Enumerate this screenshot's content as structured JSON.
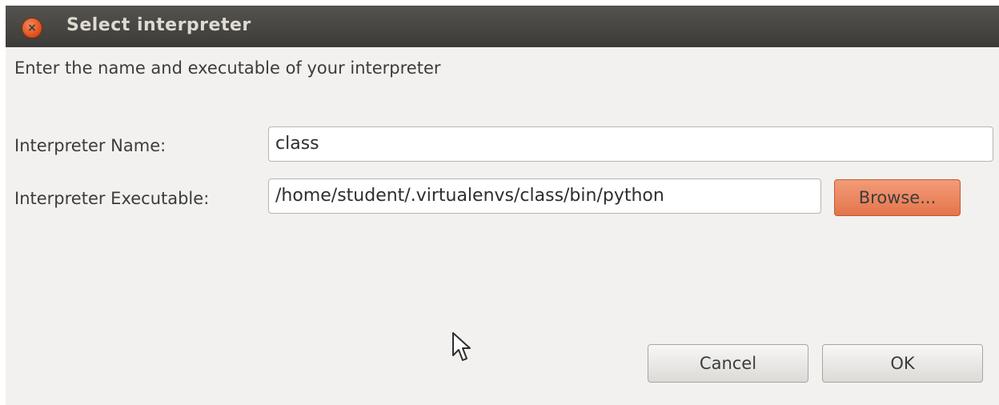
{
  "window": {
    "title": "Select interpreter"
  },
  "dialog": {
    "instructions": "Enter the name and executable of your interpreter",
    "name_label": "Interpreter Name:",
    "name_value": "class",
    "executable_label": "Interpreter Executable:",
    "executable_value": "/home/student/.virtualenvs/class/bin/python",
    "browse_label": "Browse...",
    "cancel_label": "Cancel",
    "ok_label": "OK"
  },
  "icons": {
    "close": "close-icon",
    "cursor": "mouse-pointer-icon"
  },
  "colors": {
    "titlebar": "#3c3b37",
    "title_text": "#dfdbd2",
    "close_button": "#df4a16",
    "browse_button": "#e4754b",
    "dialog_background": "#f2f1f0"
  }
}
